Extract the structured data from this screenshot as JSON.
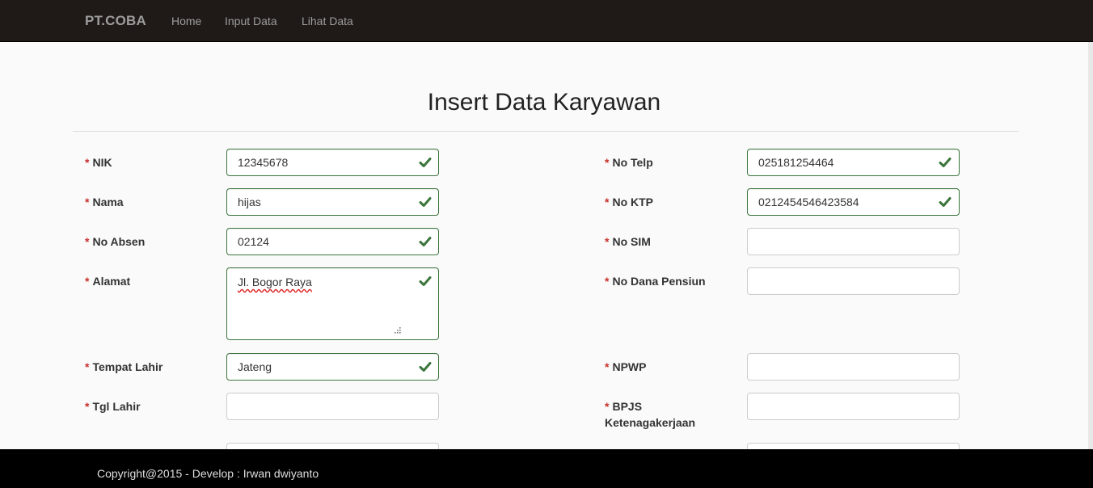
{
  "navbar": {
    "brand": "PT.COBA",
    "links": [
      "Home",
      "Input Data",
      "Lihat Data"
    ]
  },
  "page": {
    "title": "Insert Data Karyawan",
    "required_marker": "*"
  },
  "form": {
    "nik": {
      "label": "NIK",
      "value": "12345678",
      "valid": true
    },
    "nama": {
      "label": "Nama",
      "value": "hijas",
      "valid": true
    },
    "no_absen": {
      "label": "No Absen",
      "value": "02124",
      "valid": true
    },
    "alamat": {
      "label": "Alamat",
      "value": "Jl. Bogor Raya",
      "valid": true
    },
    "tempat_lahir": {
      "label": "Tempat Lahir",
      "value": "Jateng",
      "valid": true
    },
    "tgl_lahir": {
      "label": "Tgl Lahir",
      "value": "",
      "valid": false
    },
    "no_telp": {
      "label": "No Telp",
      "value": "025181254464",
      "valid": true
    },
    "no_ktp": {
      "label": "No KTP",
      "value": "0212454546423584",
      "valid": true
    },
    "no_sim": {
      "label": "No SIM",
      "value": "",
      "valid": false
    },
    "no_dana_pensiun": {
      "label": "No Dana Pensiun",
      "value": "",
      "valid": false
    },
    "npwp": {
      "label": "NPWP",
      "value": "",
      "valid": false
    },
    "bpjs": {
      "label_line1": "BPJS",
      "label_line2": "Ketenagakerjaan",
      "value": "",
      "valid": false
    }
  },
  "footer": {
    "text": "Copyright@2015 - Develop : Irwan dwiyanto"
  },
  "colors": {
    "navbar_bg": "#1f1a17",
    "valid_green": "#3c763d",
    "required_red": "#c9302c",
    "footer_bg": "#000000"
  },
  "icons": {
    "valid": "check-icon",
    "resize": "resize-handle-icon"
  }
}
